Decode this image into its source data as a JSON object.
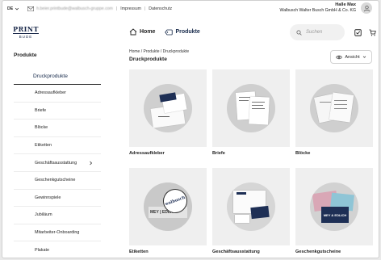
{
  "topbar": {
    "language": "DE",
    "email": "h.beier.printbude@walbusch-gruppe.com",
    "links": [
      "Impressum",
      "Datenschutz"
    ]
  },
  "user": {
    "name": "Halle Max",
    "company": "Walbusch Walter Busch GmbH & Co. KG"
  },
  "logo": {
    "line1": "PRINT",
    "line2": "BUDE"
  },
  "nav": {
    "home": "Home",
    "products": "Produkte"
  },
  "search": {
    "placeholder": "Suchen"
  },
  "sidebar": {
    "heading": "Produkte",
    "selected": "Druckprodukte",
    "items": [
      "Adressaufkleber",
      "Briefe",
      "Blöcke",
      "Etiketten",
      "Geschäftsausstattung",
      "Geschenkgutscheine",
      "Gewinnspiele",
      "Jubiläum",
      "Mitarbeiter-Onboarding",
      "Plakate"
    ]
  },
  "breadcrumb": "Home / Produkte / Druckprodukte",
  "page_title": "Druckprodukte",
  "view_button": "Ansicht",
  "products": [
    {
      "label": "Adressaufkleber"
    },
    {
      "label": "Briefe"
    },
    {
      "label": "Blöcke"
    },
    {
      "label": "Etiketten"
    },
    {
      "label": "Geschäftsausstattung"
    },
    {
      "label": "Geschenkgutscheine"
    }
  ],
  "product_art": {
    "brand": "walbusch",
    "sticker_text": "MEY | EDLICH",
    "voucher_text": "MEY & EDLICH"
  },
  "icons": {
    "language_chevron": "chevron-down-icon",
    "email": "mail-icon",
    "avatar": "user-icon",
    "home": "home-icon",
    "products": "tag-icon",
    "search": "search-icon",
    "checklist": "checkbox-icon",
    "cart": "cart-icon",
    "view": "eye-icon",
    "submenu": "chevron-right-icon"
  },
  "colors": {
    "brand_navy": "#16294a",
    "card_bg": "#efefef"
  }
}
